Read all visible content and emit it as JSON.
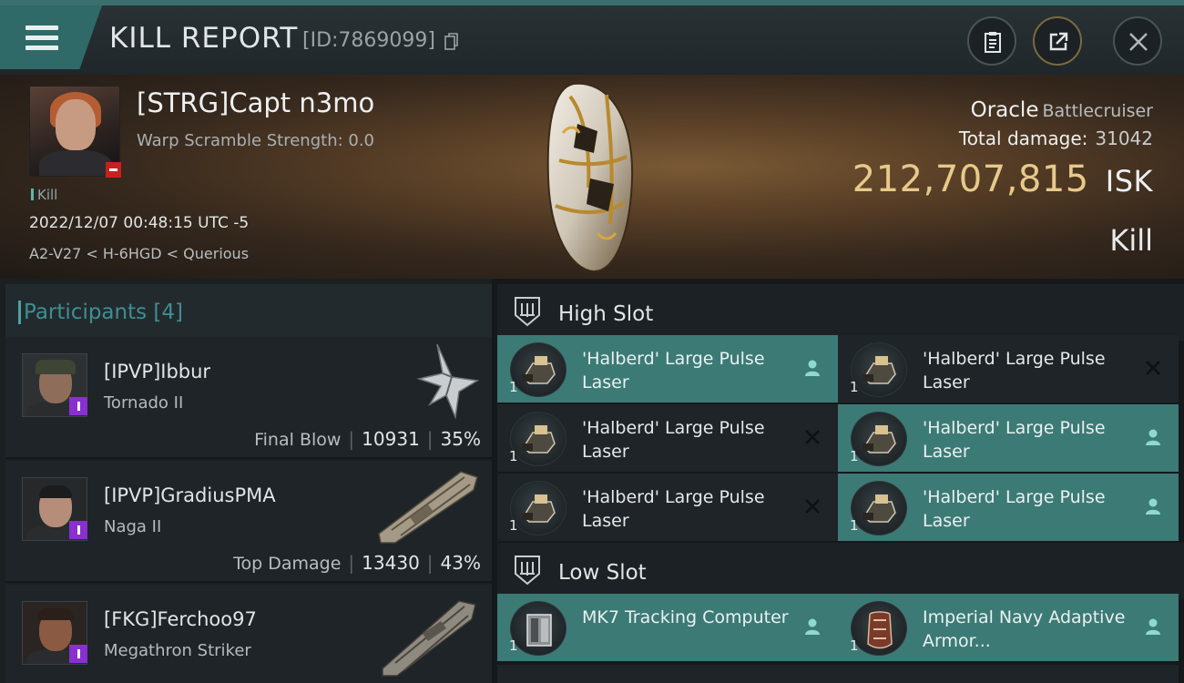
{
  "header": {
    "title": "KILL REPORT",
    "report_id": "[ID:7869099]"
  },
  "victim": {
    "name": "[STRG]Capt n3mo",
    "warp_scramble": "Warp Scramble Strength: 0.0",
    "tag": "Kill",
    "datetime": "2022/12/07 00:48:15 UTC -5",
    "location": "A2-V27 < H-6HGD < Querious",
    "ship_name": "Oracle",
    "ship_class": "Battlecruiser",
    "damage_label": "Total damage:",
    "damage_value": "31042",
    "isk_value": "212,707,815",
    "isk_unit": "ISK",
    "result": "Kill"
  },
  "participants": {
    "label": "Participants",
    "count": "[4]",
    "rows": [
      {
        "name": "[IPVP]Ibbur",
        "ship": "Tornado II",
        "stat_label": "Final Blow",
        "damage": "10931",
        "percent": "35%"
      },
      {
        "name": "[IPVP]GradiusPMA",
        "ship": "Naga II",
        "stat_label": "Top Damage",
        "damage": "13430",
        "percent": "43%"
      },
      {
        "name": "[FKG]Ferchoo97",
        "ship": "Megathron Striker"
      }
    ]
  },
  "fitting": {
    "high_slot_label": "High Slot",
    "low_slot_label": "Low Slot",
    "high_slots": [
      {
        "name": "'Halberd' Large Pulse Laser",
        "qty": "1",
        "status": "person-icon"
      },
      {
        "name": "'Halberd' Large Pulse Laser",
        "qty": "1",
        "status": "destroyed-x-icon"
      },
      {
        "name": "'Halberd' Large Pulse Laser",
        "qty": "1",
        "status": "destroyed-x-icon"
      },
      {
        "name": "'Halberd' Large Pulse Laser",
        "qty": "1",
        "status": "person-icon"
      },
      {
        "name": "'Halberd' Large Pulse Laser",
        "qty": "1",
        "status": "destroyed-x-icon"
      },
      {
        "name": "'Halberd' Large Pulse Laser",
        "qty": "1",
        "status": "person-icon"
      }
    ],
    "low_slots": [
      {
        "name": "MK7 Tracking Computer",
        "qty": "1",
        "status": "person-icon"
      },
      {
        "name": "Imperial Navy Adaptive Armor...",
        "qty": "1",
        "status": "person-icon"
      }
    ]
  },
  "colors": {
    "accent_teal": "#3c7a76",
    "isk_gold": "#e7c98a",
    "participants_label": "#3d8f92"
  }
}
